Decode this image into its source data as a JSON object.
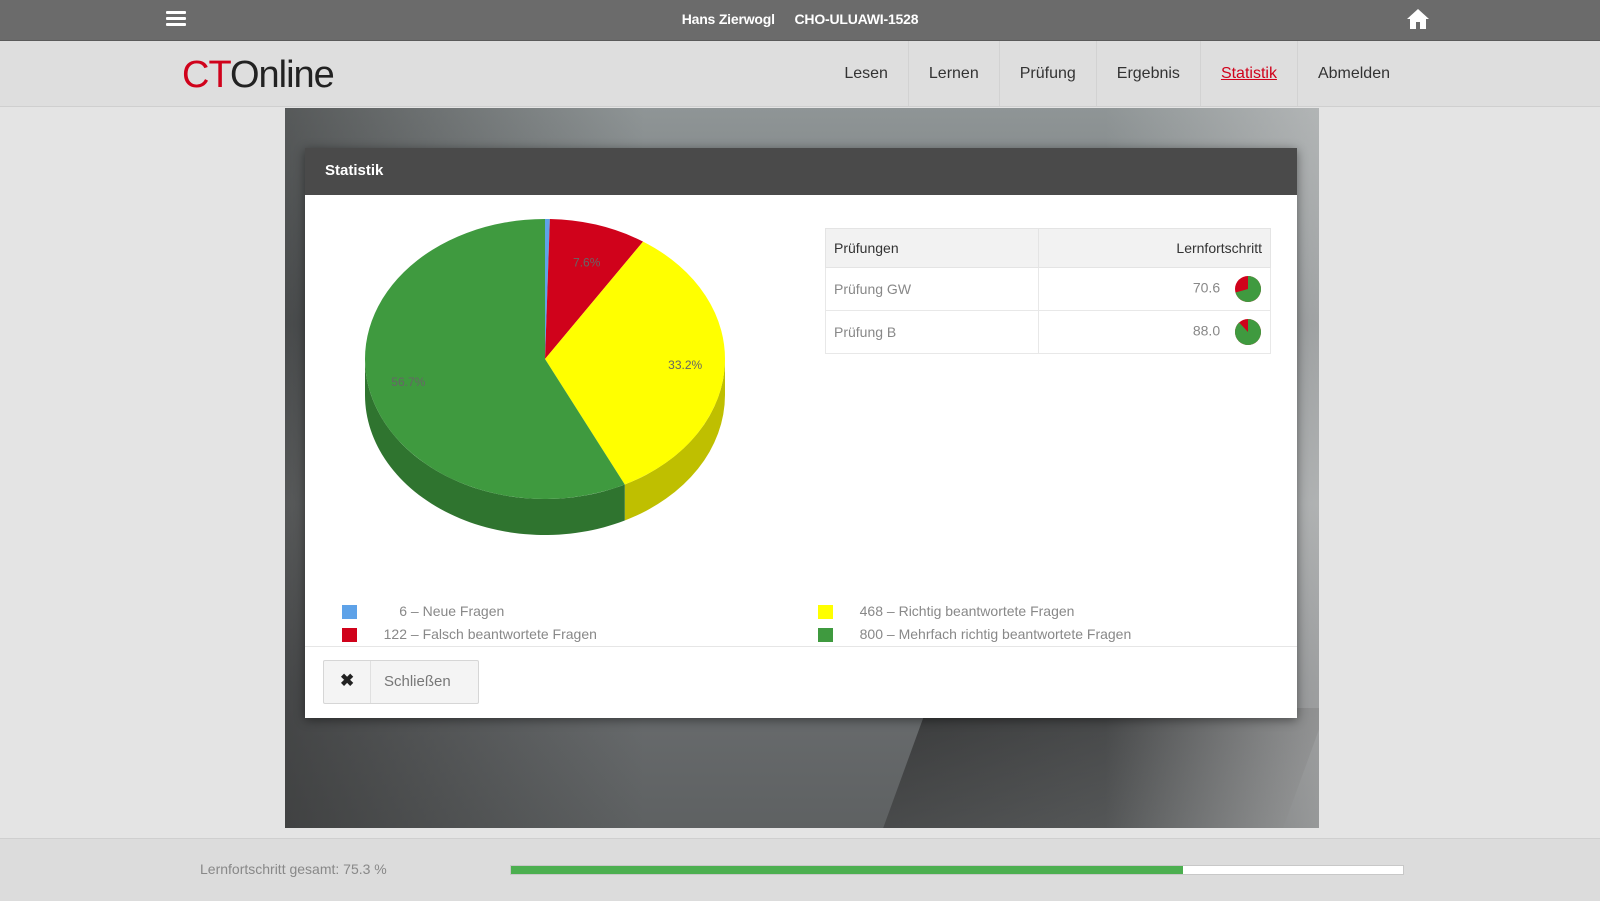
{
  "topbar": {
    "user": "Hans Zierwogl",
    "device": "CHO-ULUAWI-1528"
  },
  "nav": {
    "logo_ct": "CT",
    "logo_online": "Online",
    "items": [
      {
        "label": "Lesen",
        "active": false
      },
      {
        "label": "Lernen",
        "active": false
      },
      {
        "label": "Prüfung",
        "active": false
      },
      {
        "label": "Ergebnis",
        "active": false
      },
      {
        "label": "Statistik",
        "active": true
      },
      {
        "label": "Abmelden",
        "active": false
      }
    ]
  },
  "dialog": {
    "title": "Statistik",
    "table": {
      "headers": [
        "Prüfungen",
        "Lernfortschritt"
      ],
      "rows": [
        {
          "name": "Prüfung GW",
          "value": "70.6",
          "progress": 0.706
        },
        {
          "name": "Prüfung B",
          "value": "88.0",
          "progress": 0.88
        }
      ]
    },
    "legend": [
      {
        "count": "6",
        "text": "Neue Fragen",
        "color": "#5ea2e8"
      },
      {
        "count": "122",
        "text": "Falsch beantwortete Fragen",
        "color": "#d0021b"
      },
      {
        "count": "468",
        "text": "Richtig beantwortete Fragen",
        "color": "#ffff00"
      },
      {
        "count": "800",
        "text": "Mehrfach richtig beantwortete Fragen",
        "color": "#3f9a3f"
      }
    ],
    "close_label": "Schließen"
  },
  "chart_data": {
    "type": "pie",
    "labels": [
      "Neue Fragen",
      "Falsch beantwortete Fragen",
      "Richtig beantwortete Fragen",
      "Mehrfach richtig beantwortete Fragen"
    ],
    "values": [
      6,
      122,
      468,
      800
    ],
    "percent_labels": [
      "",
      "7.6%",
      "33.2%",
      "56.7%"
    ],
    "colors": [
      "#5ea2e8",
      "#d0021b",
      "#ffff00",
      "#3f9a3f"
    ]
  },
  "footer": {
    "progress_text": "Lernfortschritt gesamt: 75.3 %",
    "progress": 0.753
  }
}
